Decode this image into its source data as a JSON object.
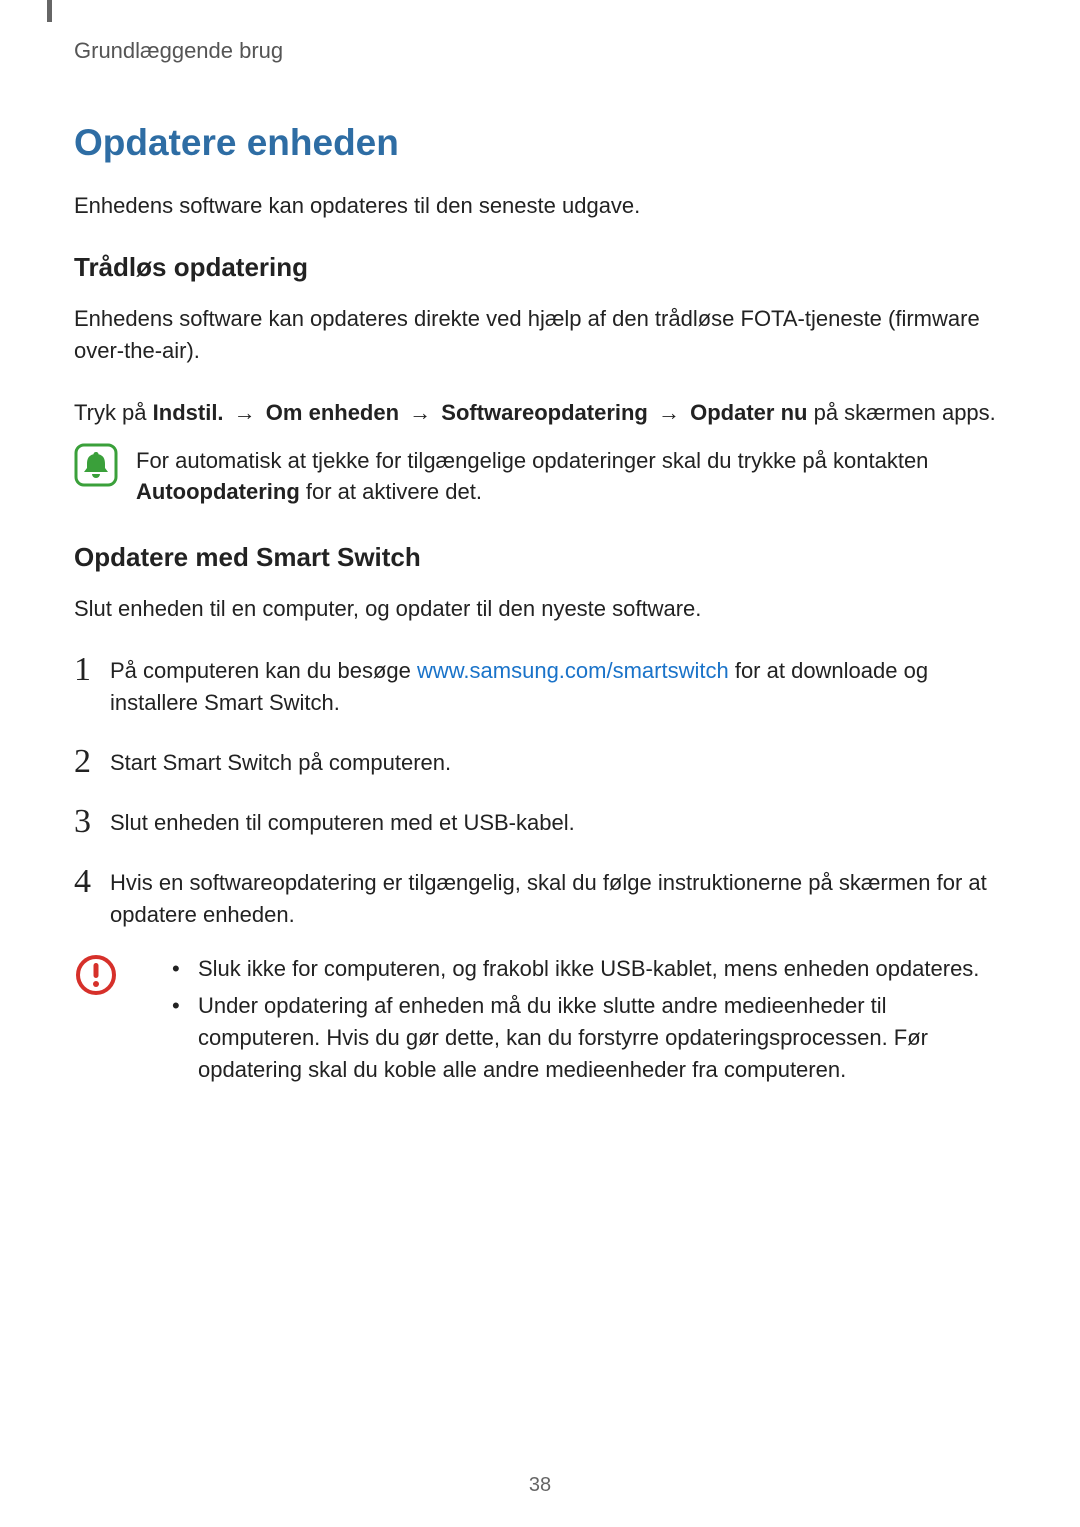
{
  "breadcrumb": "Grundlæggende brug",
  "title": "Opdatere enheden",
  "intro": "Enhedens software kan opdateres til den seneste udgave.",
  "section1": {
    "heading": "Trådløs opdatering",
    "body": "Enhedens software kan opdateres direkte ved hjælp af den trådløse FOTA-tjeneste (firmware over-the-air).",
    "path_prefix": "Tryk på ",
    "path_parts": {
      "p1": "Indstil.",
      "p2": "Om enheden",
      "p3": "Softwareopdatering",
      "p4": "Opdater nu"
    },
    "path_suffix": " på skærmen apps.",
    "arrow": "→",
    "note": {
      "before": "For automatisk at tjekke for tilgængelige opdateringer skal du trykke på kontakten ",
      "bold": "Autoopdatering",
      "after": " for at aktivere det."
    }
  },
  "section2": {
    "heading": "Opdatere med Smart Switch",
    "body": "Slut enheden til en computer, og opdater til den nyeste software.",
    "steps": {
      "n1": "1",
      "s1_before": "På computeren kan du besøge ",
      "s1_link": "www.samsung.com/smartswitch",
      "s1_after": " for at downloade og installere Smart Switch.",
      "n2": "2",
      "s2": "Start Smart Switch på computeren.",
      "n3": "3",
      "s3": "Slut enheden til computeren med et USB-kabel.",
      "n4": "4",
      "s4": "Hvis en softwareopdatering er tilgængelig, skal du følge instruktionerne på skærmen for at opdatere enheden."
    },
    "caution": {
      "b1": "Sluk ikke for computeren, og frakobl ikke USB-kablet, mens enheden opdateres.",
      "b2": "Under opdatering af enheden må du ikke slutte andre medieenheder til computeren. Hvis du gør dette, kan du forstyrre opdateringsprocessen. Før opdatering skal du koble alle andre medieenheder fra computeren."
    }
  },
  "page_number": "38"
}
